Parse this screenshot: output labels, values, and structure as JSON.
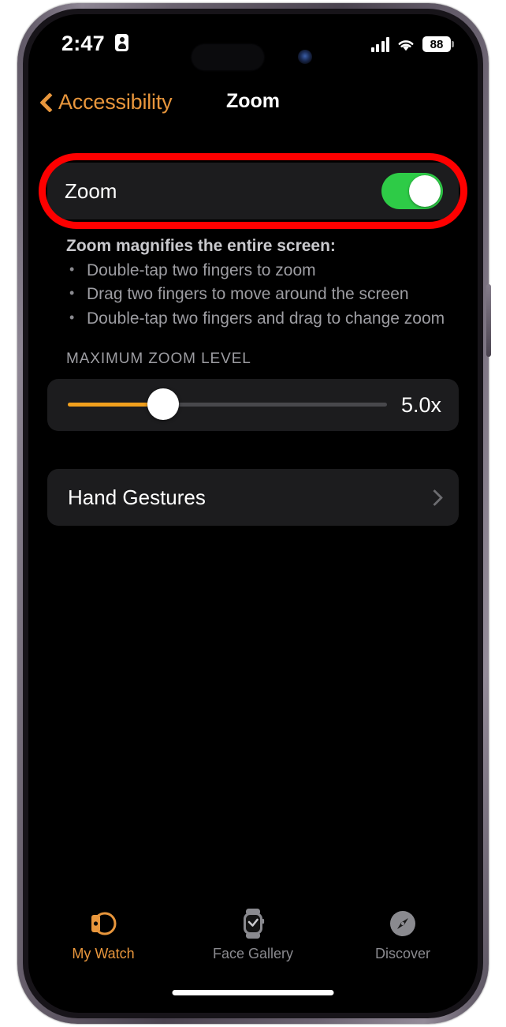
{
  "status_bar": {
    "time": "2:47",
    "person_icon": "person-card-icon",
    "signal_icon": "cellular-signal-icon",
    "wifi_icon": "wifi-icon",
    "battery_level": "88",
    "battery_icon": "battery-icon"
  },
  "nav": {
    "back_label": "Accessibility",
    "back_icon": "chevron-left-icon",
    "title": "Zoom"
  },
  "zoom_row": {
    "label": "Zoom",
    "toggle_state": "on",
    "toggle_color": "#2ecb47"
  },
  "annotation": {
    "shape": "rounded-rectangle-outline",
    "color": "#fe0000"
  },
  "description": {
    "title": "Zoom magnifies the entire screen:",
    "bullets": [
      "Double-tap two fingers to zoom",
      "Drag two fingers to move around the screen",
      "Double-tap two fingers and drag to change zoom"
    ]
  },
  "max_zoom": {
    "section_header": "MAXIMUM ZOOM LEVEL",
    "value_label": "5.0x",
    "slider_percent": 30,
    "fill_color": "#f2a01d"
  },
  "hand_gestures": {
    "label": "Hand Gestures",
    "chevron_icon": "chevron-right-icon"
  },
  "tabs": [
    {
      "label": "My Watch",
      "icon": "watch-side-icon",
      "active": true
    },
    {
      "label": "Face Gallery",
      "icon": "watch-face-check-icon",
      "active": false
    },
    {
      "label": "Discover",
      "icon": "compass-icon",
      "active": false
    }
  ],
  "accent_color": "#e8963c"
}
